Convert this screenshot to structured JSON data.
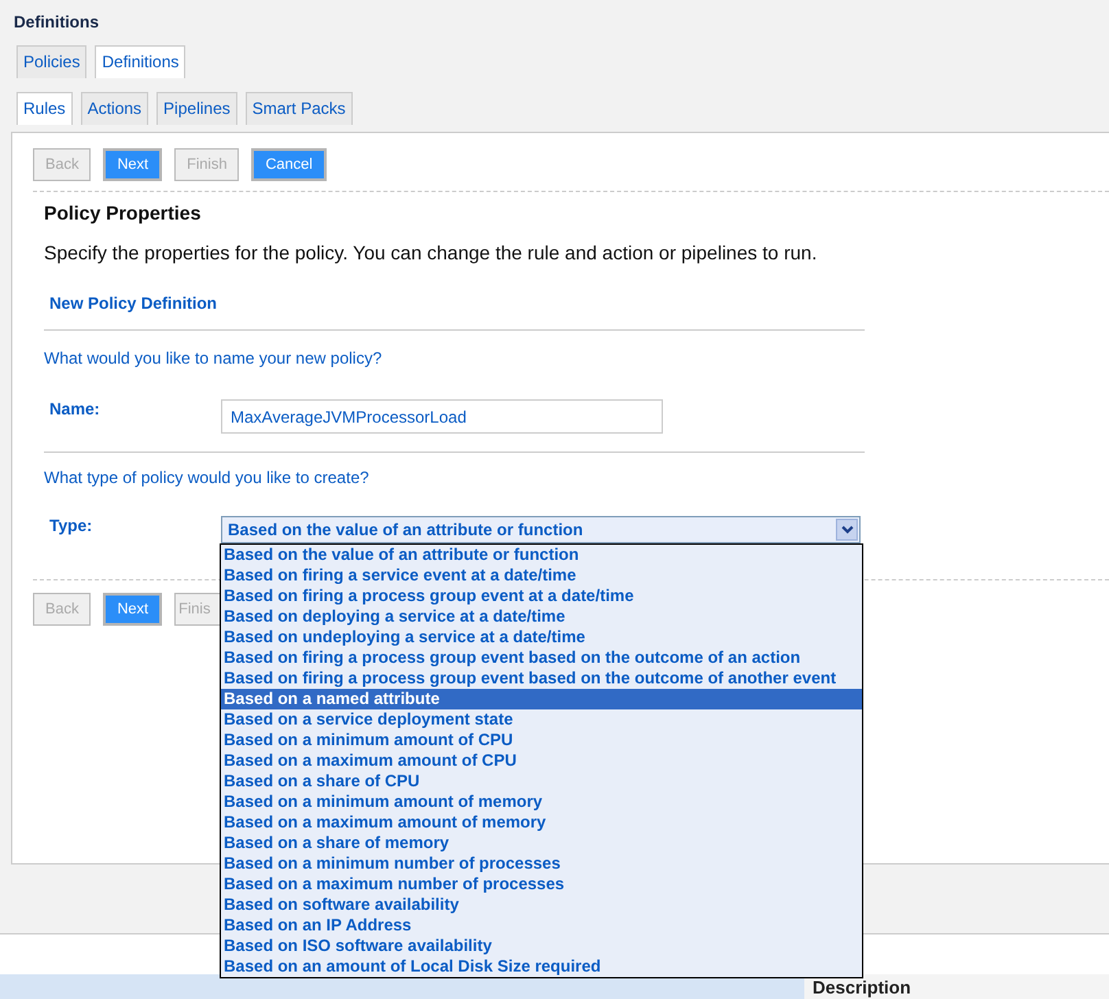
{
  "header": {
    "title": "Definitions"
  },
  "tabs": [
    {
      "label": "Policies",
      "selected": false
    },
    {
      "label": "Definitions",
      "selected": true
    }
  ],
  "subtabs": [
    {
      "label": "Rules",
      "selected": true
    },
    {
      "label": "Actions",
      "selected": false
    },
    {
      "label": "Pipelines",
      "selected": false
    },
    {
      "label": "Smart Packs",
      "selected": false
    }
  ],
  "wizard_buttons_top": [
    {
      "label": "Back",
      "disabled": true
    },
    {
      "label": "Next",
      "disabled": false
    },
    {
      "label": "Finish",
      "disabled": true
    },
    {
      "label": "Cancel",
      "disabled": false
    }
  ],
  "section_title": "Policy Properties",
  "description": "Specify the properties for the policy. You can change the rule and action or pipelines to run.",
  "form": {
    "heading": "New Policy Definition",
    "name_question": "What would you like to name your new policy?",
    "name_label": "Name:",
    "name_value": "MaxAverageJVMProcessorLoad",
    "type_question": "What type of policy would you like to create?",
    "type_label": "Type:",
    "type_value": "Based on the value of an attribute or function",
    "type_options": [
      {
        "label": "Based on the value of an attribute or function",
        "selected": false
      },
      {
        "label": "Based on firing a service event at a date/time",
        "selected": false
      },
      {
        "label": "Based on firing a process group event at a date/time",
        "selected": false
      },
      {
        "label": "Based on deploying a service at a date/time",
        "selected": false
      },
      {
        "label": "Based on undeploying a service at a date/time",
        "selected": false
      },
      {
        "label": "Based on firing a process group event based on the outcome of an action",
        "selected": false
      },
      {
        "label": "Based on firing a process group event based on the outcome of another event",
        "selected": false
      },
      {
        "label": "Based on a named attribute",
        "selected": true
      },
      {
        "label": "Based on a service deployment state",
        "selected": false
      },
      {
        "label": "Based on a minimum amount of CPU",
        "selected": false
      },
      {
        "label": "Based on a maximum amount of CPU",
        "selected": false
      },
      {
        "label": "Based on a share of CPU",
        "selected": false
      },
      {
        "label": "Based on a minimum amount of memory",
        "selected": false
      },
      {
        "label": "Based on a maximum amount of memory",
        "selected": false
      },
      {
        "label": "Based on a share of memory",
        "selected": false
      },
      {
        "label": "Based on a minimum number of processes",
        "selected": false
      },
      {
        "label": "Based on a maximum number of processes",
        "selected": false
      },
      {
        "label": "Based on software availability",
        "selected": false
      },
      {
        "label": "Based on an IP Address",
        "selected": false
      },
      {
        "label": "Based on ISO software availability",
        "selected": false
      },
      {
        "label": "Based on an amount of Local Disk Size required",
        "selected": false
      }
    ]
  },
  "wizard_buttons_bottom": [
    {
      "label": "Back",
      "disabled": true
    },
    {
      "label": "Next",
      "disabled": false
    },
    {
      "label": "Finis",
      "disabled": true
    }
  ],
  "footer": {
    "column_heading": "Description"
  }
}
